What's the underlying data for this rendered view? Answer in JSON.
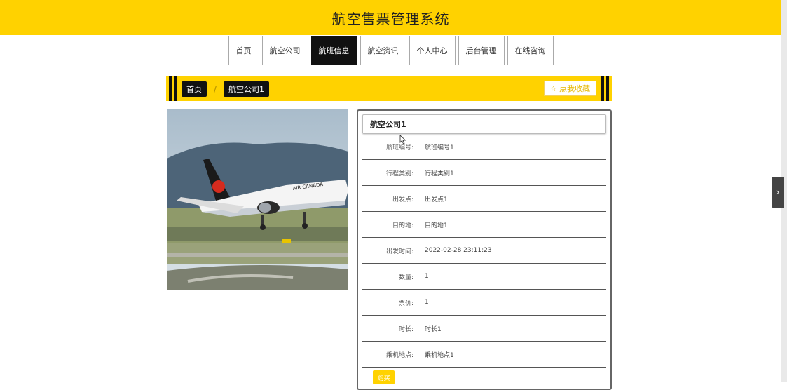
{
  "header": {
    "title": "航空售票管理系统"
  },
  "nav": {
    "items": [
      {
        "label": "首页"
      },
      {
        "label": "航空公司"
      },
      {
        "label": "航班信息"
      },
      {
        "label": "航空资讯"
      },
      {
        "label": "个人中心"
      },
      {
        "label": "后台管理"
      },
      {
        "label": "在线咨询"
      }
    ],
    "active_index": 2
  },
  "breadcrumb": {
    "home": "首页",
    "separator": "/",
    "current": "航空公司1"
  },
  "favorite_button": {
    "icon": "star-outline-icon",
    "label": "☆ 点我收藏"
  },
  "photo": {
    "airline_text": "AIR CANADA"
  },
  "detail": {
    "title": "航空公司1",
    "fields": [
      {
        "label": "航班编号:",
        "value": "航班编号1"
      },
      {
        "label": "行程类别:",
        "value": "行程类别1"
      },
      {
        "label": "出发点:",
        "value": "出发点1"
      },
      {
        "label": "目的地:",
        "value": "目的地1"
      },
      {
        "label": "出发时间:",
        "value": "2022-02-28 23:11:23"
      },
      {
        "label": "数量:",
        "value": "1"
      },
      {
        "label": "票价:",
        "value": "1"
      },
      {
        "label": "时长:",
        "value": "时长1"
      },
      {
        "label": "乘机地点:",
        "value": "乘机地点1"
      }
    ],
    "buy_label": "购买"
  },
  "colors": {
    "brand_yellow": "#ffd200",
    "dark": "#111111"
  },
  "side_arrow": {
    "icon": "chevron-right-icon",
    "glyph": "›"
  }
}
